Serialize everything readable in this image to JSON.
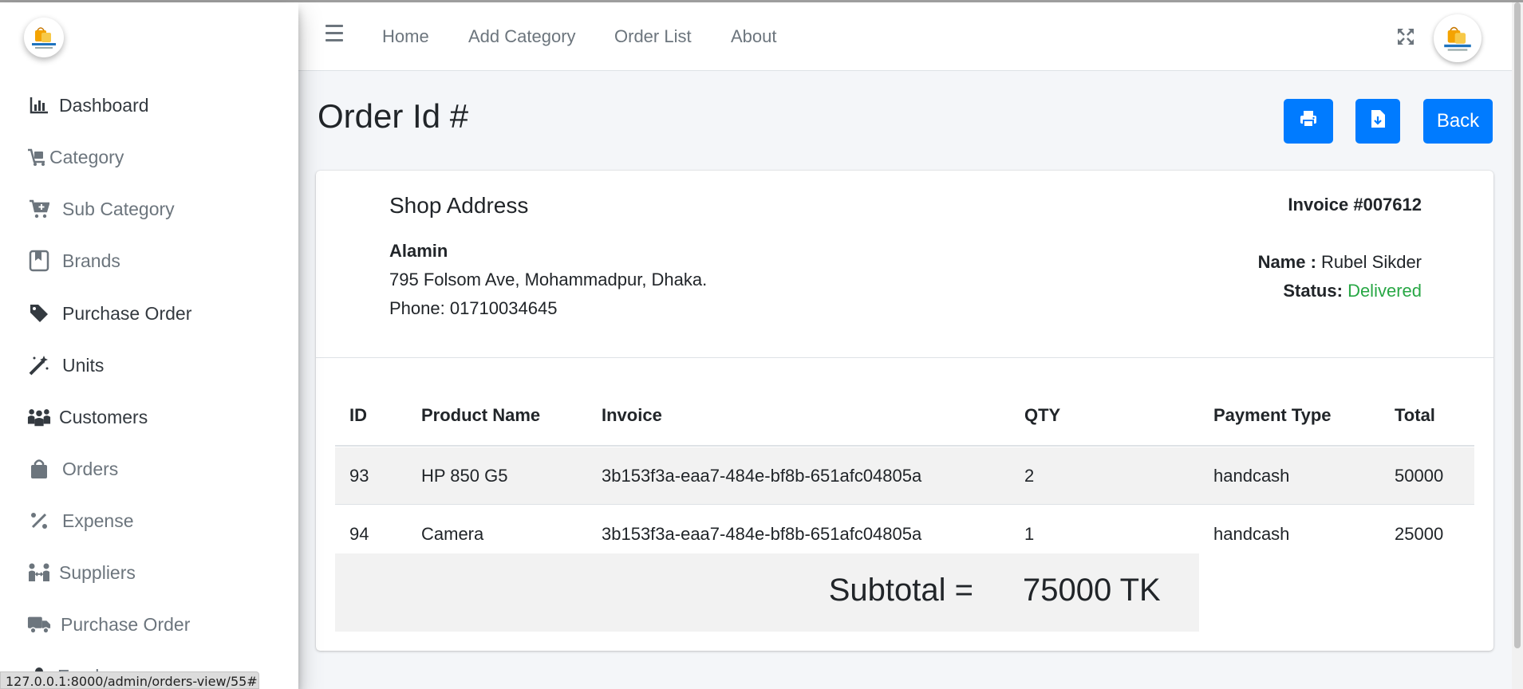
{
  "sidebar": {
    "logo_icon": "shop-bag-logo-icon",
    "items": [
      {
        "label": "Dashboard",
        "icon": "chart-bar-icon"
      },
      {
        "label": "Category",
        "icon": "cart-flatbed-icon"
      },
      {
        "label": "Sub Category",
        "icon": "cart-plus-icon"
      },
      {
        "label": "Brands",
        "icon": "book-bookmark-icon"
      },
      {
        "label": "Purchase Order",
        "icon": "tag-icon"
      },
      {
        "label": "Units",
        "icon": "magic-wand-icon"
      },
      {
        "label": "Customers",
        "icon": "people-group-icon"
      },
      {
        "label": "Orders",
        "icon": "shopping-bag-icon"
      },
      {
        "label": "Expense",
        "icon": "percent-icon"
      },
      {
        "label": "Suppliers",
        "icon": "people-arrows-icon"
      },
      {
        "label": "Purchase Order",
        "icon": "truck-icon"
      },
      {
        "label": "Employee",
        "icon": "user-icon"
      }
    ]
  },
  "status_url": "127.0.0.1:8000/admin/orders-view/55#",
  "navbar": {
    "links": [
      "Home",
      "Add Category",
      "Order List",
      "About"
    ],
    "menu_icon": "hamburger-icon",
    "fullscreen_icon": "expand-icon"
  },
  "page": {
    "title": "Order Id #",
    "back_label": "Back",
    "print_icon": "print-icon",
    "download_icon": "file-download-icon"
  },
  "invoice": {
    "shop_title": "Shop Address",
    "shop_name": "Alamin",
    "shop_address": "795 Folsom Ave, Mohammadpur, Dhaka.",
    "shop_phone": "Phone: 01710034645",
    "invoice_number": "Invoice #007612",
    "name_label": "Name :",
    "name_value": "Rubel Sikder",
    "status_label": "Status:",
    "status_value": "Delivered",
    "status_color": "#28a745"
  },
  "table": {
    "headers": [
      "ID",
      "Product Name",
      "Invoice",
      "QTY",
      "Payment Type",
      "Total"
    ],
    "rows": [
      [
        "93",
        "HP 850 G5",
        "3b153f3a-eaa7-484e-bf8b-651afc04805a",
        "2",
        "handcash",
        "50000"
      ],
      [
        "94",
        "Camera",
        "3b153f3a-eaa7-484e-bf8b-651afc04805a",
        "1",
        "handcash",
        "25000"
      ]
    ]
  },
  "subtotal": {
    "label": "Subtotal =",
    "value": "75000 TK"
  },
  "colors": {
    "accent": "#007bff",
    "status_green": "#28a745"
  }
}
